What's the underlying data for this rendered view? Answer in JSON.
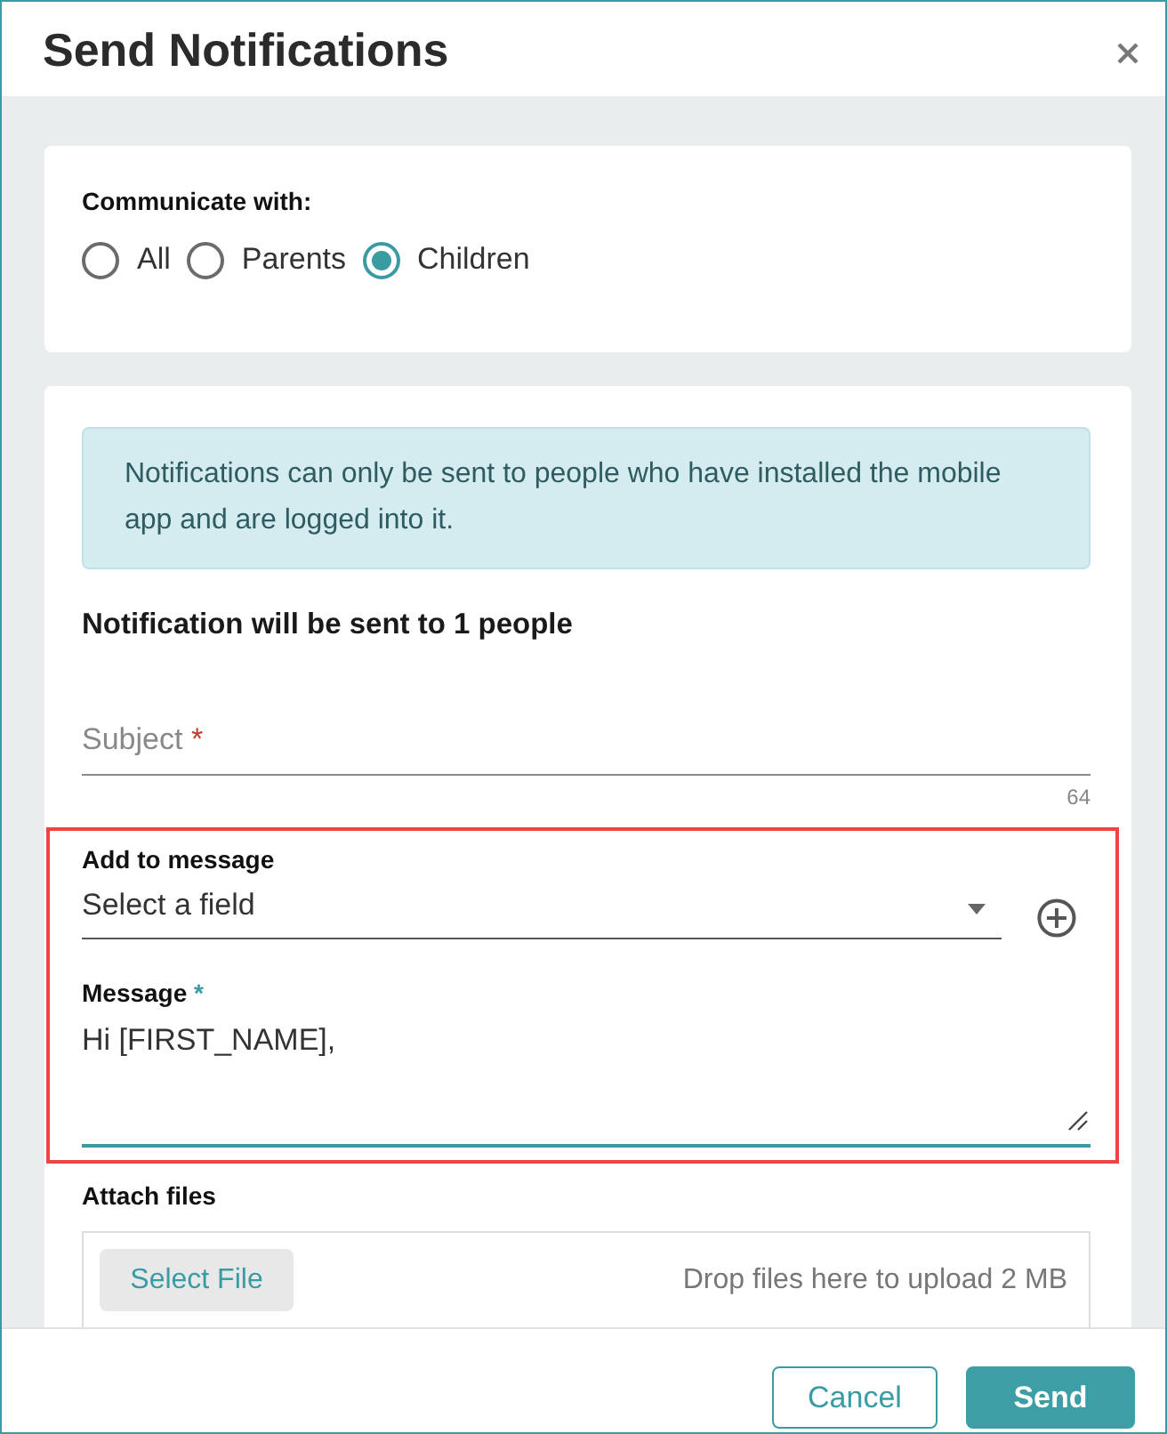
{
  "window": {
    "title": "Send Notifications"
  },
  "communicate_with": {
    "label": "Communicate with:",
    "options": [
      {
        "label": "All",
        "selected": false
      },
      {
        "label": "Parents",
        "selected": false
      },
      {
        "label": "Children",
        "selected": true
      }
    ]
  },
  "notice": "Notifications can only be sent to people who have installed the mobile app and are logged into it.",
  "recipients": "Notification will be sent to 1 people",
  "subject": {
    "label": "Subject",
    "required_mark": "*",
    "focused": false,
    "counter": "64"
  },
  "compose": {
    "highlighted": true,
    "add_to_message": {
      "label": "Add to message",
      "value": "Select a field"
    },
    "message": {
      "label": "Message",
      "required_mark": "*",
      "focused": true,
      "value": "Hi [FIRST_NAME],"
    }
  },
  "attach": {
    "label": "Attach files",
    "button": "Select File",
    "hint": "Drop files here to upload 2 MB"
  },
  "buttons": [
    {
      "label": "Cancel",
      "kind": "secondary"
    },
    {
      "label": "Send",
      "kind": "primary"
    }
  ]
}
